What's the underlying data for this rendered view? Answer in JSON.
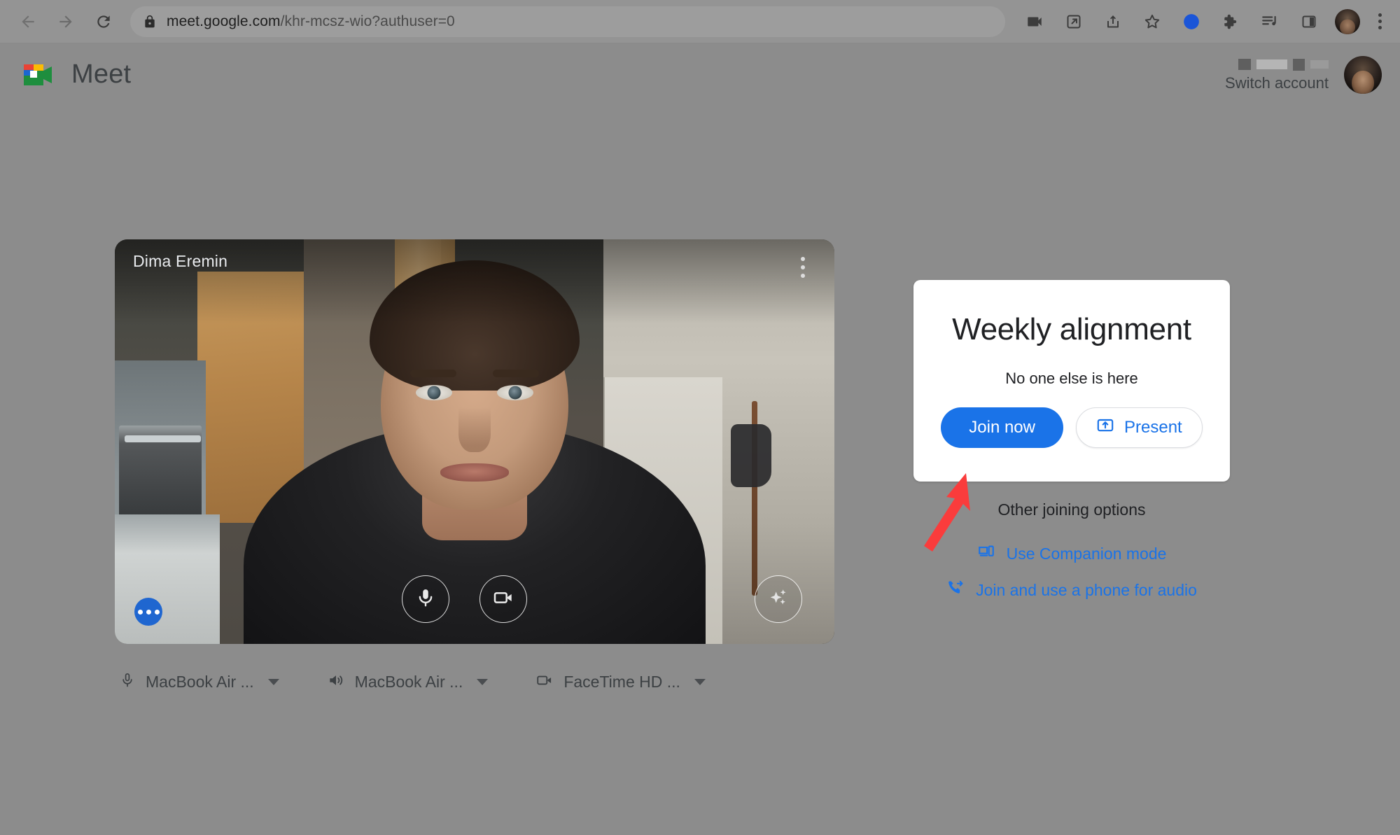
{
  "browser": {
    "url_host": "meet.google.com",
    "url_path": "/khr-mcsz-wio?authuser=0",
    "back_icon": "back-arrow-icon",
    "forward_icon": "forward-arrow-icon",
    "reload_icon": "reload-icon",
    "lock_icon": "lock-icon",
    "toolbar_icons": [
      "video-camera-icon",
      "open-in-new-icon",
      "share-icon",
      "star-bookmark-icon",
      "blue-circle-icon",
      "extensions-puzzle-icon",
      "media-playlist-icon",
      "side-panel-icon"
    ],
    "profile_avatar": "browser-profile-avatar",
    "menu_icon": "three-dot-menu-icon"
  },
  "meet_header": {
    "logo": "google-meet-logo",
    "title": "Meet",
    "switch_account_label": "Switch account",
    "account_email_redacted": true,
    "avatar": "account-avatar"
  },
  "preview": {
    "participant_name": "Dima Eremin",
    "kebab_icon": "more-options-icon",
    "mic_icon": "microphone-icon",
    "camera_icon": "video-camera-icon",
    "effects_icon": "sparkles-effects-icon",
    "network_badge_icon": "more-dots-badge-icon"
  },
  "devices": [
    {
      "icon": "microphone-icon",
      "label": "MacBook Air ...",
      "caret": "chevron-down-icon"
    },
    {
      "icon": "speaker-icon",
      "label": "MacBook Air ...",
      "caret": "chevron-down-icon"
    },
    {
      "icon": "video-camera-icon",
      "label": "FaceTime HD ...",
      "caret": "chevron-down-icon"
    }
  ],
  "join_panel": {
    "title": "Weekly alignment",
    "subtitle": "No one else is here",
    "join_button": "Join now",
    "present_button": "Present",
    "present_icon": "present-screen-icon",
    "other_options_title": "Other joining options",
    "companion_label": "Use Companion mode",
    "companion_icon": "companion-devices-icon",
    "phone_label": "Join and use a phone for audio",
    "phone_icon": "phone-forward-icon"
  },
  "annotation": {
    "arrow": "red-arrow-pointing-to-join-now",
    "color": "#fa3c3c"
  },
  "colors": {
    "accent_blue": "#1a73e8",
    "page_background": "#8c8c8c",
    "card_background": "#ffffff",
    "text_primary": "#202124"
  }
}
